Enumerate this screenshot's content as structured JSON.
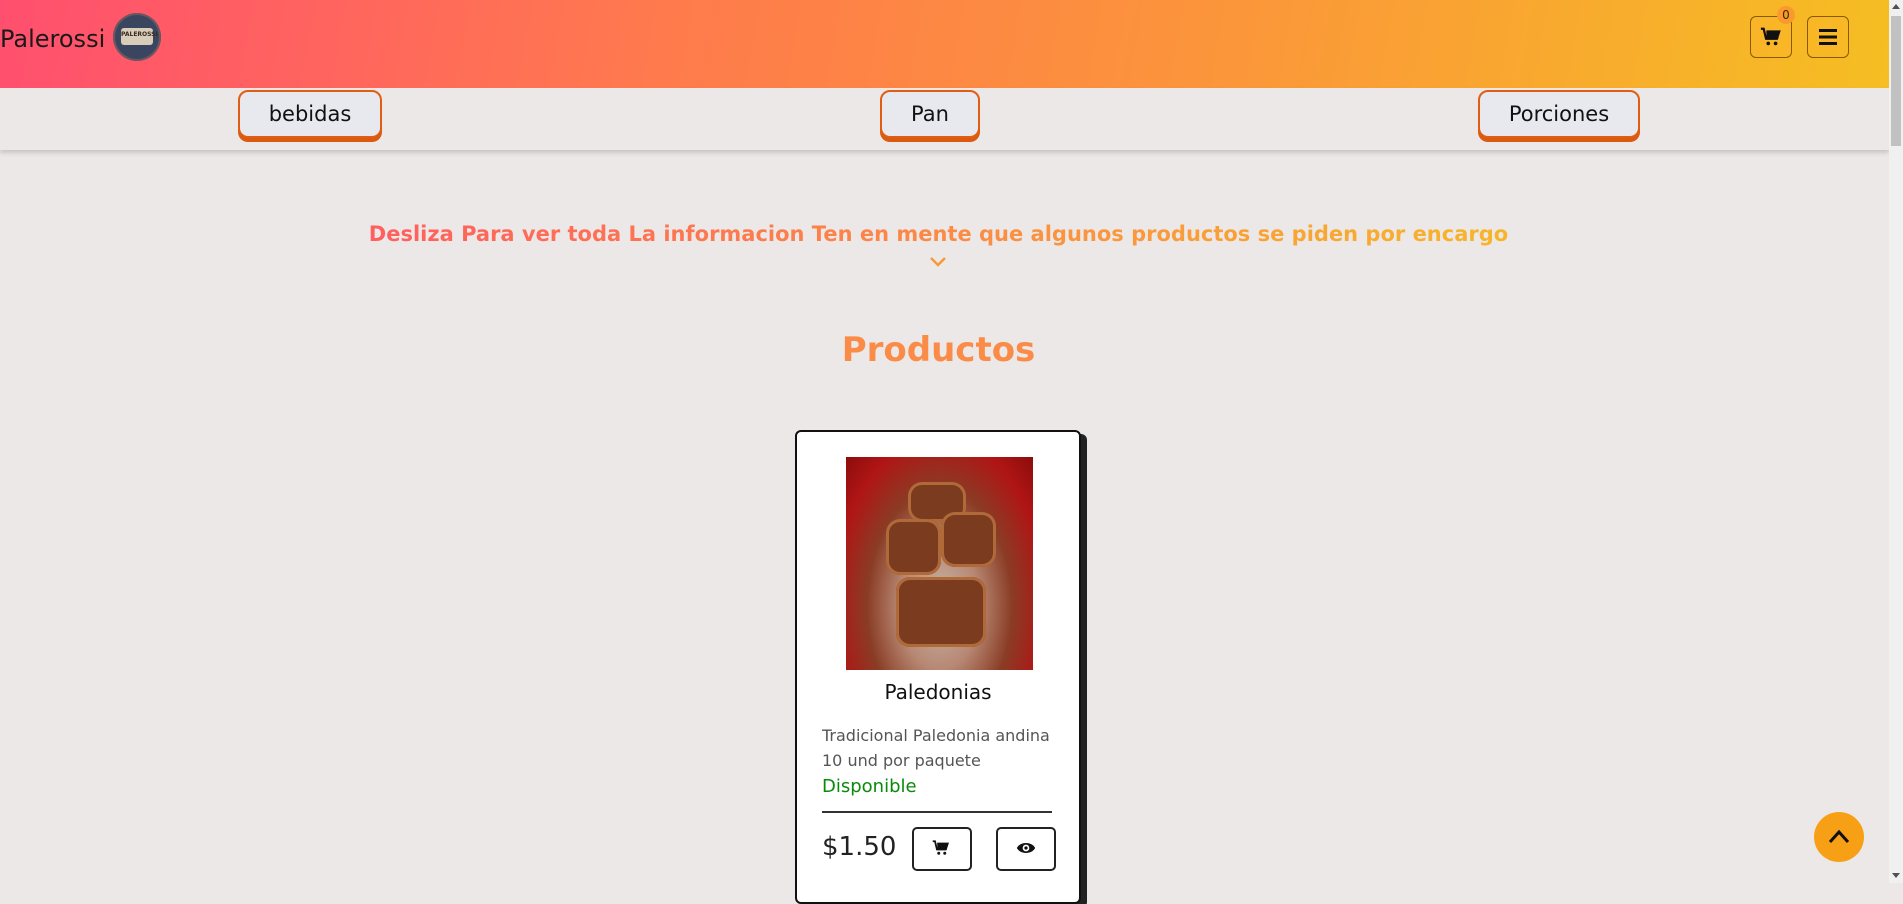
{
  "header": {
    "brand": "Palerossi",
    "logo_text": "PALEROSSI",
    "cart_count": "0",
    "icons": {
      "cart": "cart-icon",
      "menu": "hamburger-menu-icon"
    }
  },
  "categories": [
    {
      "label": "bebidas"
    },
    {
      "label": "Pan"
    },
    {
      "label": "Porciones"
    }
  ],
  "hint": "Desliza Para ver toda La informacion Ten en mente que algunos productos se piden por encargo",
  "section_title": "Productos",
  "products": [
    {
      "name": "Paledonias",
      "description": "Tradicional Paledonia andina 10 und por paquete",
      "status": "Disponible",
      "price": "$1.50"
    }
  ],
  "colors": {
    "accent_orange": "#fb8c48",
    "available_green": "#0a8a0a",
    "category_border": "#e05e14"
  }
}
